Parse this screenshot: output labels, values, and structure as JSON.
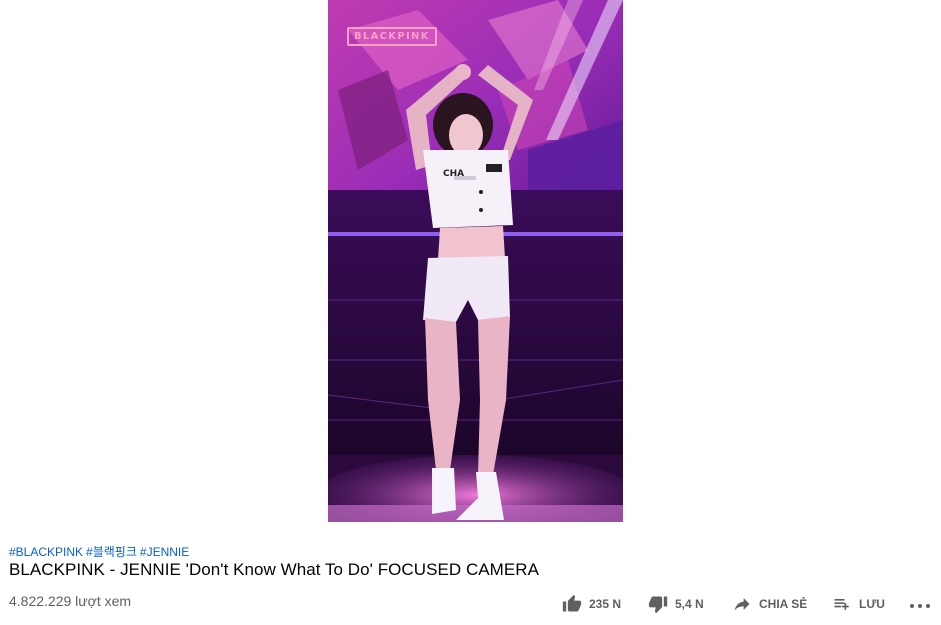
{
  "player": {
    "overlay_logo_text": "BLACKPINK",
    "shirt_text": "CHA"
  },
  "video": {
    "hashtags": [
      "#BLACKPINK",
      "#블랙핑크",
      "#JENNIE"
    ],
    "title": "BLACKPINK - JENNIE 'Don't Know What To Do' FOCUSED CAMERA",
    "views": "4.822.229 lượt xem"
  },
  "actions": {
    "like_count": "235 N",
    "dislike_count": "5,4 N",
    "share_label": "CHIA SẺ",
    "save_label": "LƯU"
  },
  "icons": {
    "like": "thumbs-up-icon",
    "dislike": "thumbs-down-icon",
    "share": "share-arrow-icon",
    "save": "playlist-add-icon",
    "more": "more-horizontal-icon"
  },
  "colors": {
    "link": "#065fd4",
    "title": "#030303",
    "secondary": "#606060",
    "stage_purple": "#6a1f9e",
    "stage_pink": "#e03bb8"
  }
}
